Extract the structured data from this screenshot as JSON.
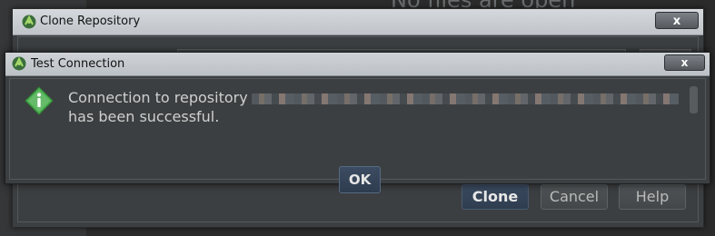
{
  "background": {
    "heading": "No files are open"
  },
  "clone_dialog": {
    "title": "Clone Repository",
    "close_label": "x",
    "buttons": {
      "clone": "Clone",
      "cancel": "Cancel",
      "help": "Help"
    }
  },
  "test_connection": {
    "title": "Test Connection",
    "close_label": "x",
    "message_line1": "Connection to repository",
    "message_line2": "has been successful.",
    "ok_label": "OK",
    "icon": "info-icon"
  },
  "colors": {
    "dialog_bg": "#3c3f41",
    "primary_button": "#2f3d4f",
    "info_green": "#4caf50"
  }
}
